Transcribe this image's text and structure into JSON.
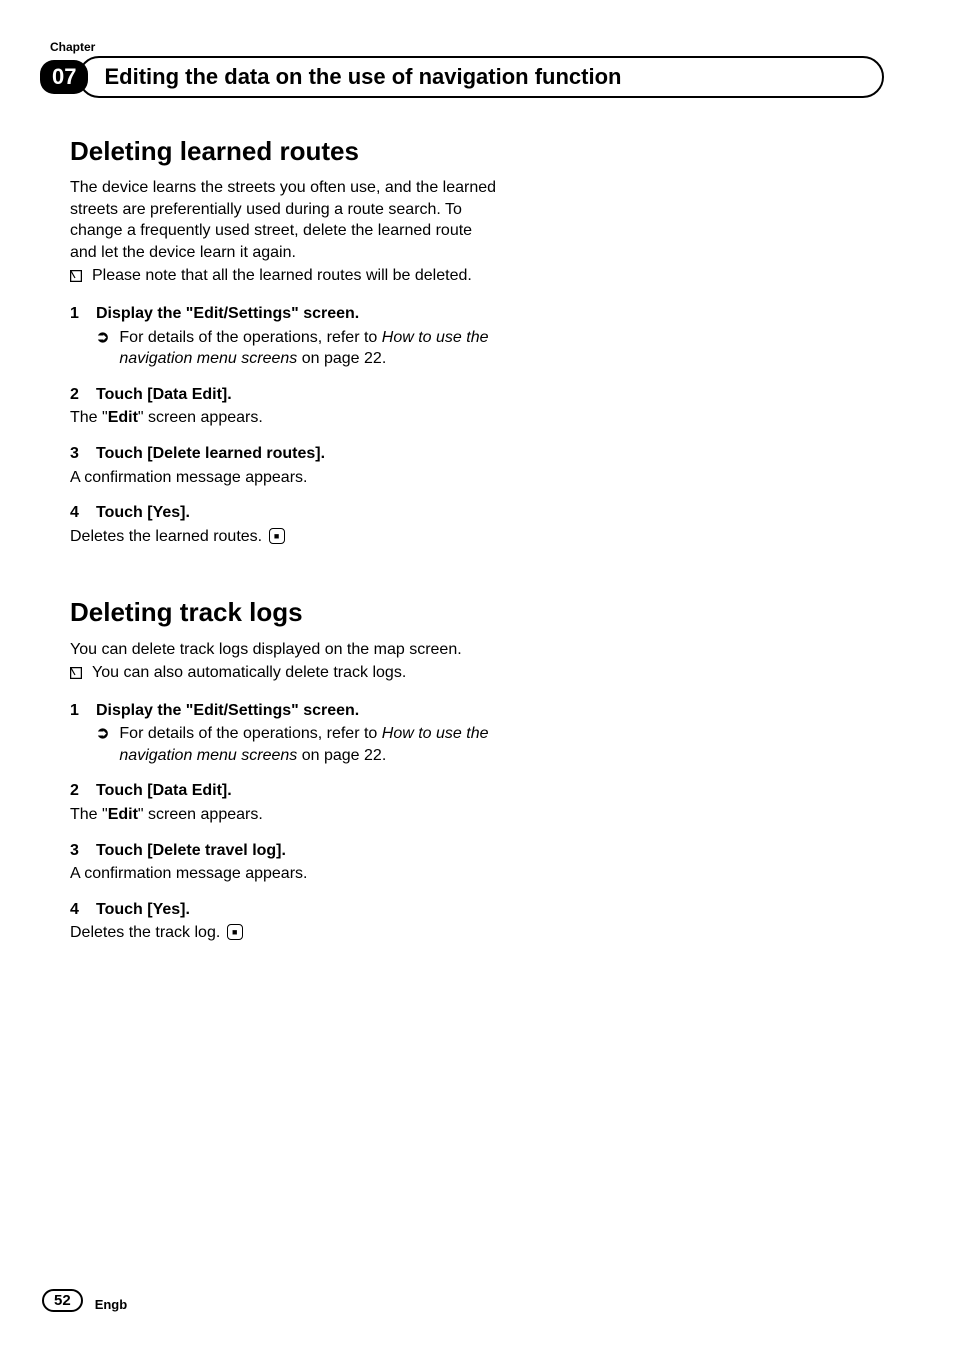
{
  "chapter_label": "Chapter",
  "chapter_number": "07",
  "header_title": "Editing the data on the use of navigation function",
  "section1": {
    "title": "Deleting learned routes",
    "intro": "The device learns the streets you often use, and the learned streets are preferentially used during a route search. To change a frequently used street, delete the learned route and let the device learn it again.",
    "note": "Please note that all the learned routes will be deleted.",
    "steps": {
      "s1_num": "1",
      "s1_title": "Display the \"Edit/Settings\" screen.",
      "s1_ref_lead": "For details of the operations, refer to ",
      "s1_ref_italic": "How to use the navigation menu screens",
      "s1_ref_tail": " on page 22.",
      "s2_num": "2",
      "s2_title": "Touch [Data Edit].",
      "s2_body_pre": "The \"",
      "s2_body_bold": "Edit",
      "s2_body_post": "\" screen appears.",
      "s3_num": "3",
      "s3_title": "Touch [Delete learned routes].",
      "s3_body": "A confirmation message appears.",
      "s4_num": "4",
      "s4_title": "Touch [Yes].",
      "s4_body": "Deletes the learned routes."
    }
  },
  "section2": {
    "title": "Deleting track logs",
    "intro": "You can delete track logs displayed on the map screen.",
    "note": "You can also automatically delete track logs.",
    "steps": {
      "s1_num": "1",
      "s1_title": "Display the \"Edit/Settings\" screen.",
      "s1_ref_lead": "For details of the operations, refer to ",
      "s1_ref_italic": "How to use the navigation menu screens",
      "s1_ref_tail": " on page 22.",
      "s2_num": "2",
      "s2_title": "Touch [Data Edit].",
      "s2_body_pre": "The \"",
      "s2_body_bold": "Edit",
      "s2_body_post": "\" screen appears.",
      "s3_num": "3",
      "s3_title": "Touch [Delete travel log].",
      "s3_body": "A confirmation message appears.",
      "s4_num": "4",
      "s4_title": "Touch [Yes].",
      "s4_body": "Deletes the track log."
    }
  },
  "footer": {
    "page": "52",
    "lang": "Engb"
  }
}
